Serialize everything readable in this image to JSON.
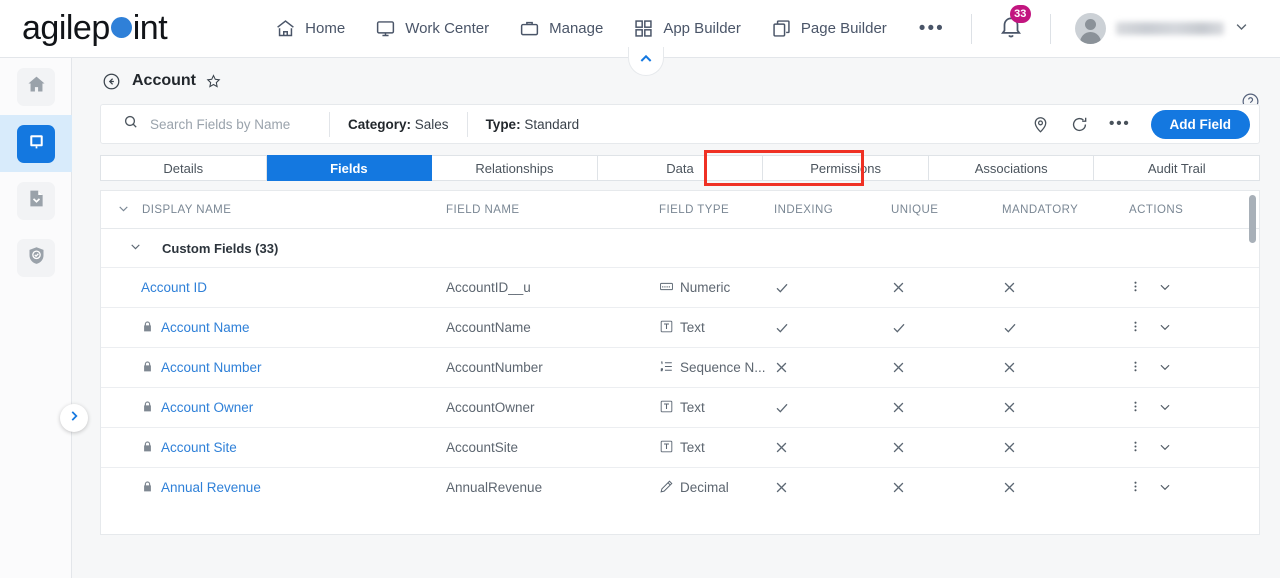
{
  "brand": {
    "name_part1": "agilep",
    "name_part2": "int",
    "dot_color": "#2f80d8"
  },
  "topnav": {
    "items": [
      {
        "label": "Home",
        "icon": "home-icon"
      },
      {
        "label": "Work Center",
        "icon": "monitor-icon"
      },
      {
        "label": "Manage",
        "icon": "briefcase-icon"
      },
      {
        "label": "App Builder",
        "icon": "grid-icon"
      },
      {
        "label": "Page Builder",
        "icon": "copy-icon"
      }
    ],
    "more_label": "•••",
    "notification_count": "33",
    "notification_color": "#c2157f",
    "user_name": ""
  },
  "sidebar": {
    "items": [
      {
        "name": "home",
        "icon": "home-icon",
        "active": false
      },
      {
        "name": "work-center",
        "icon": "monitor-icon",
        "active": true
      },
      {
        "name": "documents",
        "icon": "document-chevron-icon",
        "active": false
      },
      {
        "name": "security",
        "icon": "shield-check-icon",
        "active": false
      }
    ]
  },
  "page": {
    "title": "Account",
    "back_icon": "back-arrow-circle-icon",
    "star_icon": "star-icon",
    "help_icon": "help-circle-icon"
  },
  "toolbar": {
    "search_placeholder": "Search Fields by Name",
    "search_value": "",
    "category_label": "Category:",
    "category_value": "Sales",
    "type_label": "Type:",
    "type_value": "Standard",
    "add_field_label": "Add Field",
    "add_field_color": "#1478e0",
    "icons": [
      "location-pin-icon",
      "refresh-icon",
      "ellipsis-icon"
    ]
  },
  "tabs": [
    {
      "label": "Details",
      "active": false,
      "highlighted": false
    },
    {
      "label": "Fields",
      "active": true,
      "highlighted": false
    },
    {
      "label": "Relationships",
      "active": false,
      "highlighted": false
    },
    {
      "label": "Data",
      "active": false,
      "highlighted": false
    },
    {
      "label": "Permissions",
      "active": false,
      "highlighted": true
    },
    {
      "label": "Associations",
      "active": false,
      "highlighted": false
    },
    {
      "label": "Audit Trail",
      "active": false,
      "highlighted": false
    }
  ],
  "table": {
    "columns": [
      "DISPLAY NAME",
      "FIELD NAME",
      "FIELD TYPE",
      "INDEXING",
      "UNIQUE",
      "MANDATORY",
      "ACTIONS"
    ],
    "group": {
      "label": "Custom Fields (33)",
      "expanded": true
    },
    "rows": [
      {
        "display_name": "Account ID",
        "locked": false,
        "field_name": "AccountID__u",
        "field_type": "Numeric",
        "type_icon": "numeric-icon",
        "indexing": "check",
        "unique": "cross",
        "mandatory": "cross"
      },
      {
        "display_name": "Account Name",
        "locked": true,
        "field_name": "AccountName",
        "field_type": "Text",
        "type_icon": "text-icon",
        "indexing": "check",
        "unique": "check",
        "mandatory": "check"
      },
      {
        "display_name": "Account Number",
        "locked": true,
        "field_name": "AccountNumber",
        "field_type": "Sequence N...",
        "type_icon": "sequence-icon",
        "indexing": "cross",
        "unique": "cross",
        "mandatory": "cross"
      },
      {
        "display_name": "Account Owner",
        "locked": true,
        "field_name": "AccountOwner",
        "field_type": "Text",
        "type_icon": "text-icon",
        "indexing": "check",
        "unique": "cross",
        "mandatory": "cross"
      },
      {
        "display_name": "Account Site",
        "locked": true,
        "field_name": "AccountSite",
        "field_type": "Text",
        "type_icon": "text-icon",
        "indexing": "cross",
        "unique": "cross",
        "mandatory": "cross"
      },
      {
        "display_name": "Annual Revenue",
        "locked": true,
        "field_name": "AnnualRevenue",
        "field_type": "Decimal",
        "type_icon": "decimal-icon",
        "indexing": "cross",
        "unique": "cross",
        "mandatory": "cross"
      }
    ]
  }
}
